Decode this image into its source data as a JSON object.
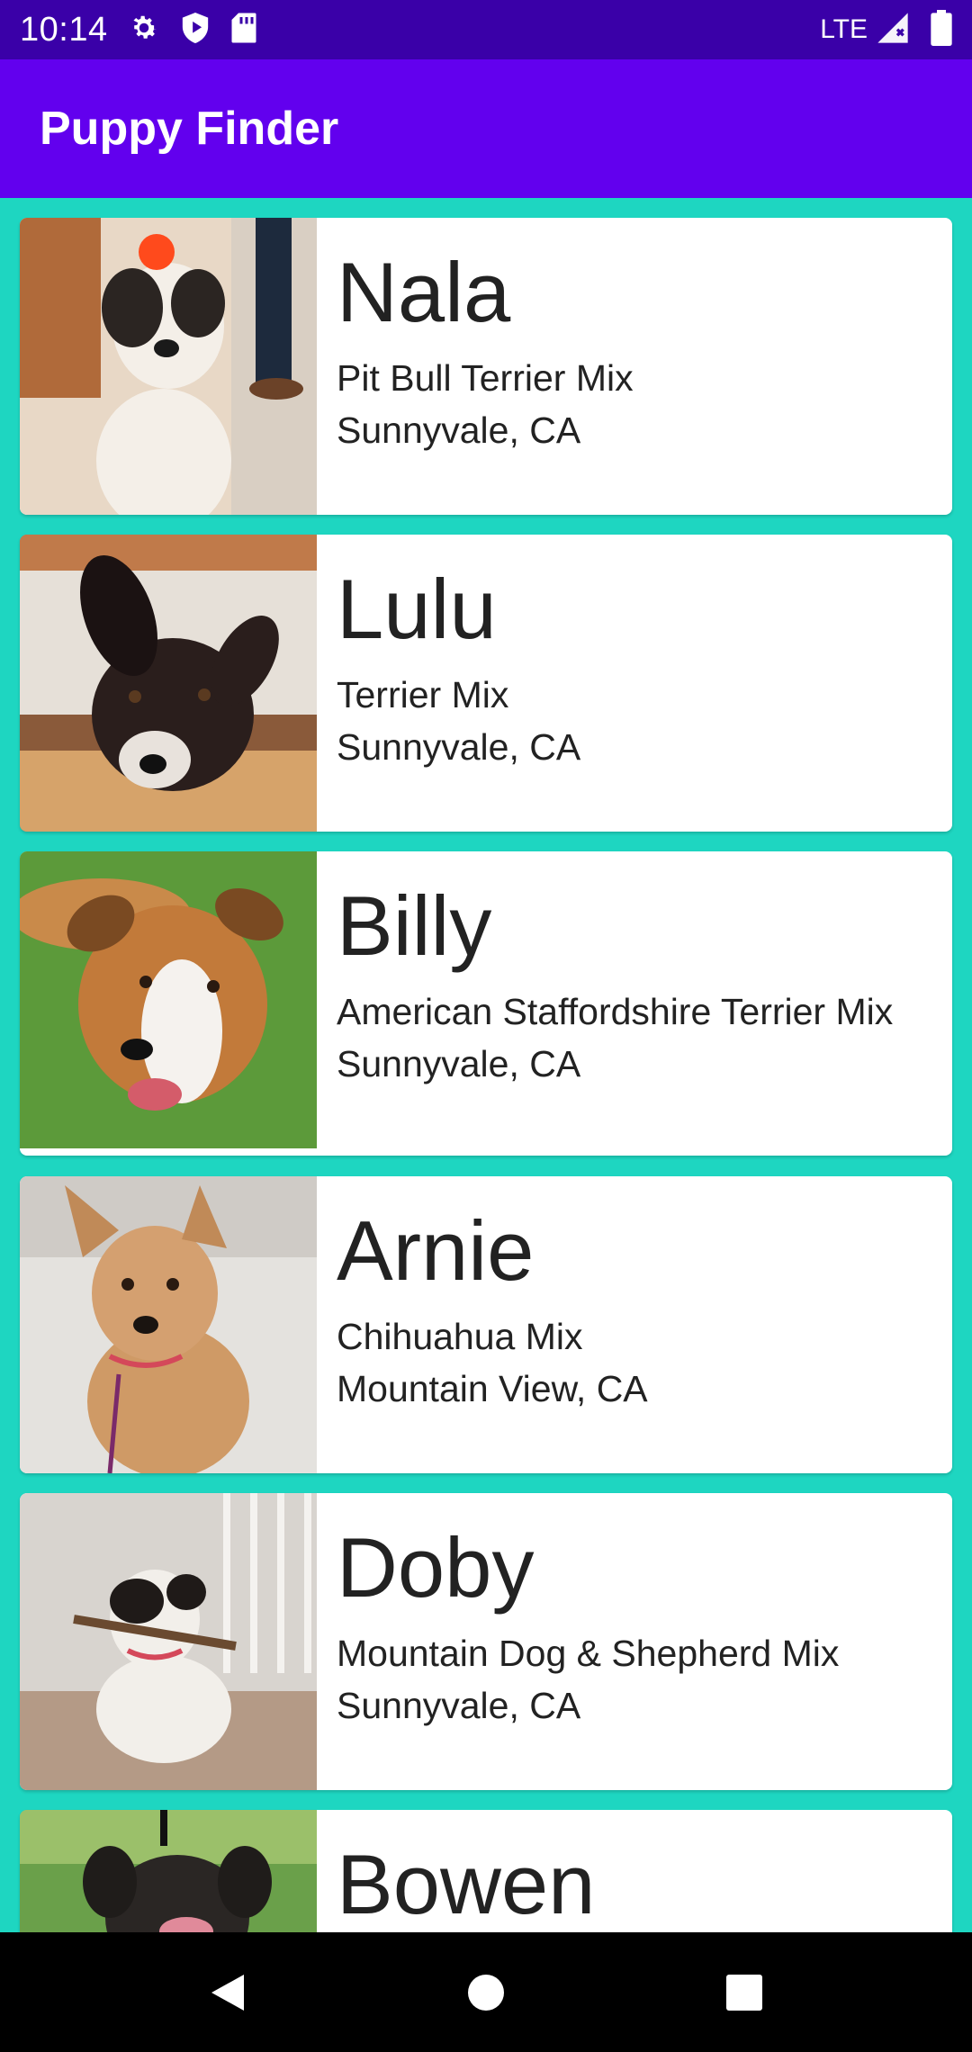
{
  "status_bar": {
    "time": "10:14",
    "network": "LTE",
    "icons": [
      "settings-icon",
      "play-protect-icon",
      "sd-card-icon",
      "signal-icon",
      "battery-icon"
    ]
  },
  "app_bar": {
    "title": "Puppy Finder"
  },
  "colors": {
    "app_bar": "#6200ee",
    "status_bar": "#3a00a8",
    "background": "#1ed6c1",
    "card": "#ffffff"
  },
  "puppies": [
    {
      "name": "Nala",
      "breed": "Pit Bull Terrier Mix",
      "location": "Sunnyvale, CA"
    },
    {
      "name": "Lulu",
      "breed": "Terrier Mix",
      "location": "Sunnyvale, CA"
    },
    {
      "name": "Billy",
      "breed": "American Staffordshire Terrier Mix",
      "location": "Sunnyvale, CA"
    },
    {
      "name": "Arnie",
      "breed": "Chihuahua Mix",
      "location": "Mountain View, CA"
    },
    {
      "name": "Doby",
      "breed": "Mountain Dog & Shepherd Mix",
      "location": "Sunnyvale, CA"
    },
    {
      "name": "Bowen",
      "breed": "",
      "location": ""
    }
  ],
  "nav_bar": {
    "buttons": [
      "back-icon",
      "home-icon",
      "recents-icon"
    ]
  }
}
